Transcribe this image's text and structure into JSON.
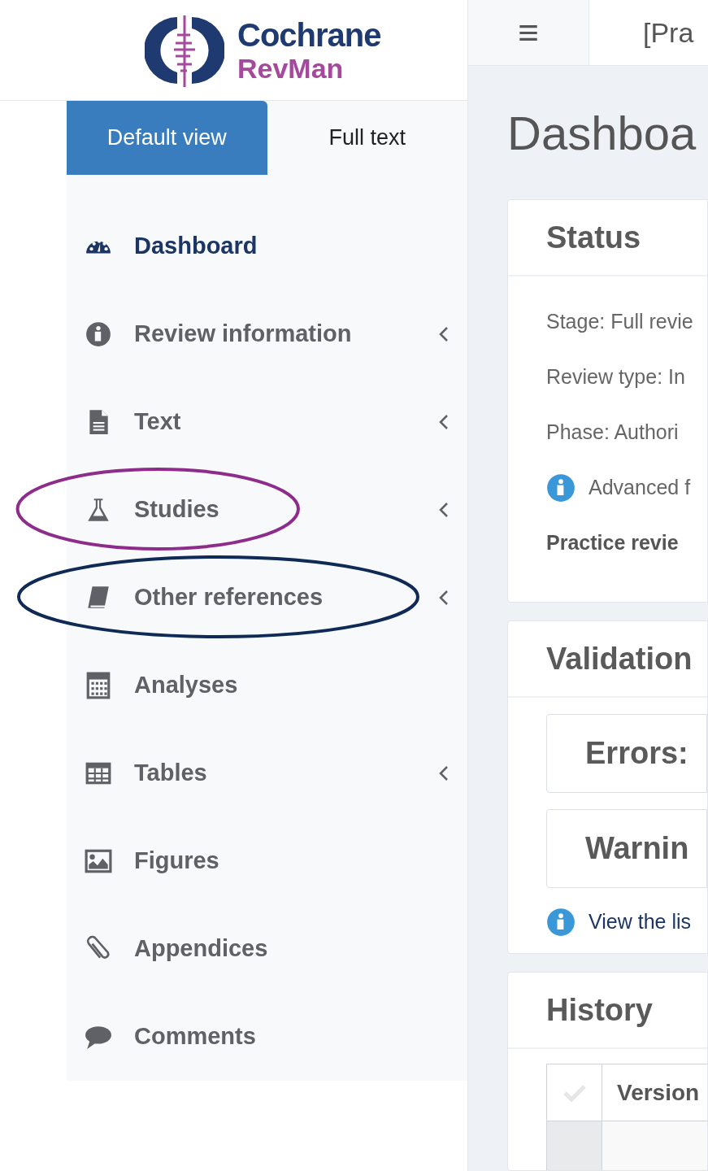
{
  "logo": {
    "name": "Cochrane",
    "product": "RevMan"
  },
  "header": {
    "menu_glyph": "≡",
    "title": "[Pra"
  },
  "view_tabs": [
    {
      "label": "Default view",
      "selected": true
    },
    {
      "label": "Full text",
      "selected": false
    }
  ],
  "nav": [
    {
      "label": "Dashboard",
      "selected": true,
      "expandable": false
    },
    {
      "label": "Review information",
      "selected": false,
      "expandable": true
    },
    {
      "label": "Text",
      "selected": false,
      "expandable": true
    },
    {
      "label": "Studies",
      "selected": false,
      "expandable": true,
      "color": "#8e2c8c"
    },
    {
      "label": "Other references",
      "selected": false,
      "expandable": true,
      "color": "#0f2a55"
    },
    {
      "label": "Analyses",
      "selected": false,
      "expandable": false
    },
    {
      "label": "Tables",
      "selected": false,
      "expandable": true
    },
    {
      "label": "Figures",
      "selected": false,
      "expandable": false
    },
    {
      "label": "Appendices",
      "selected": false,
      "expandable": false
    },
    {
      "label": "Comments",
      "selected": false,
      "expandable": false
    }
  ],
  "main": {
    "title": "Dashboa",
    "status": {
      "title": "Status",
      "lines": [
        {
          "kind": "text",
          "text": "Stage: Full revie"
        },
        {
          "kind": "text",
          "text": "Review type: In"
        },
        {
          "kind": "text",
          "text": "Phase: Authori"
        },
        {
          "kind": "info",
          "text": "Advanced f"
        },
        {
          "kind": "bold",
          "text": "Practice revie"
        }
      ]
    },
    "validation": {
      "title": "Validation",
      "boxes": [
        "Errors:",
        "Warnin"
      ],
      "note": "View the lis"
    },
    "history": {
      "title": "History",
      "columns": [
        "Version"
      ]
    }
  }
}
